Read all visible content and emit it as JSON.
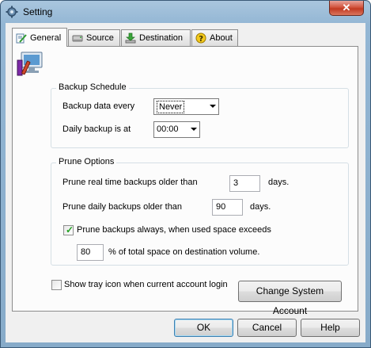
{
  "window": {
    "title": "Setting",
    "close_label": "✕"
  },
  "tabs": [
    {
      "label": "General",
      "icon": "pen-document-icon",
      "active": true
    },
    {
      "label": "Source",
      "icon": "drive-icon"
    },
    {
      "label": "Destination",
      "icon": "download-arrow-icon"
    },
    {
      "label": "About",
      "icon": "help-icon"
    }
  ],
  "schedule": {
    "group_title": "Backup Schedule",
    "every_label": "Backup data every",
    "every_value": "Never",
    "daily_label": "Daily backup is at",
    "daily_value": "00:00"
  },
  "prune": {
    "group_title": "Prune Options",
    "realtime_label": "Prune real time backups older than",
    "realtime_value": "3",
    "realtime_unit": "days.",
    "daily_label": "Prune daily backups older than",
    "daily_value": "90",
    "daily_unit": "days.",
    "always_label": "Prune backups always, when used space exceeds",
    "always_checked": true,
    "percent_value": "80",
    "percent_label": "% of total space on destination volume."
  },
  "tray": {
    "label": "Show tray icon when current account login",
    "checked": false
  },
  "buttons": {
    "change_account": "Change System Account",
    "ok": "OK",
    "cancel": "Cancel",
    "help": "Help"
  },
  "colors": {
    "accent": "#3c7fb1",
    "check": "#21a121",
    "close": "#c23a22"
  }
}
